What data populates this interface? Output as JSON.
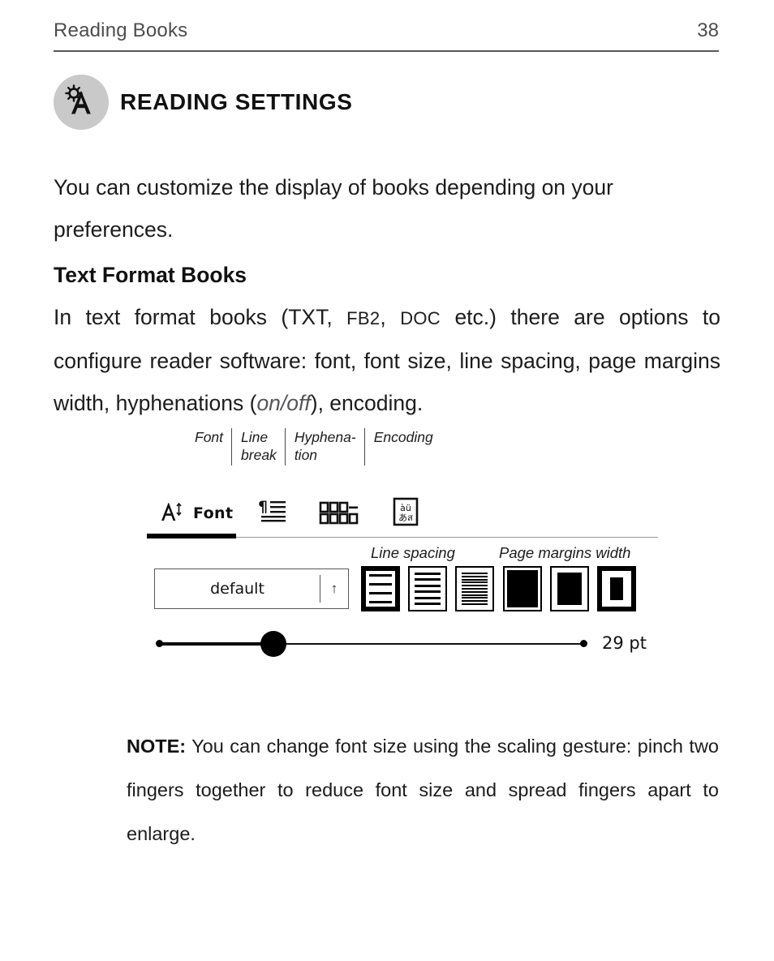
{
  "header": {
    "title": "Reading Books",
    "page_number": "38"
  },
  "section": {
    "icon": "font-settings-icon",
    "title": "READING SETTINGS"
  },
  "body": {
    "intro": "You can customize the display of books depending on your preferences.",
    "subheading": "Text Format Books",
    "paragraph_parts": {
      "p1": "In text format books (TXT, ",
      "fb2": "FB2",
      "p2": ", ",
      "doc": "DOC",
      "p3": " etc.) there are options to configure reader software: font, font size, line spacing, page margins width, hyphenations (",
      "onoff": "on/off",
      "p4": "), encoding."
    }
  },
  "mock": {
    "callouts": [
      {
        "label": "Font"
      },
      {
        "label": "Line break"
      },
      {
        "label": "Hyphena-tion"
      },
      {
        "label": "Encoding"
      }
    ],
    "tabs": [
      {
        "id": "font",
        "label": "Font",
        "icon": "font-size-a-icon",
        "selected": true
      },
      {
        "id": "line-break",
        "label": "",
        "icon": "pilcrow-lines-icon",
        "selected": false
      },
      {
        "id": "hyphenation",
        "label": "",
        "icon": "hyphenation-blocks-icon",
        "selected": false
      },
      {
        "id": "encoding",
        "label": "",
        "icon": "encoding-charset-icon",
        "selected": false
      }
    ],
    "font_select": {
      "value": "default",
      "arrow": "↑"
    },
    "line_spacing": {
      "label": "Line spacing",
      "options": [
        {
          "id": "loose",
          "line_count": 4,
          "selected": true
        },
        {
          "id": "normal",
          "line_count": 6,
          "selected": false
        },
        {
          "id": "tight",
          "line_count": 11,
          "selected": false
        }
      ]
    },
    "page_margins": {
      "label": "Page margins width",
      "options": [
        {
          "id": "narrow",
          "selected": false
        },
        {
          "id": "medium",
          "selected": false
        },
        {
          "id": "wide",
          "selected": true
        }
      ]
    },
    "font_size_slider": {
      "value_label": "29 pt",
      "fill_percent": 27
    }
  },
  "note": {
    "label": "NOTE:",
    "text": " You can change font size using the scaling gesture: pinch two fingers together to reduce font size and spread fingers apart to enlarge."
  },
  "colors": {
    "header_gray": "#4d4d4f",
    "icon_bg": "#c9c9c9",
    "ink": "#1c1c1c",
    "accent": "#000000"
  }
}
